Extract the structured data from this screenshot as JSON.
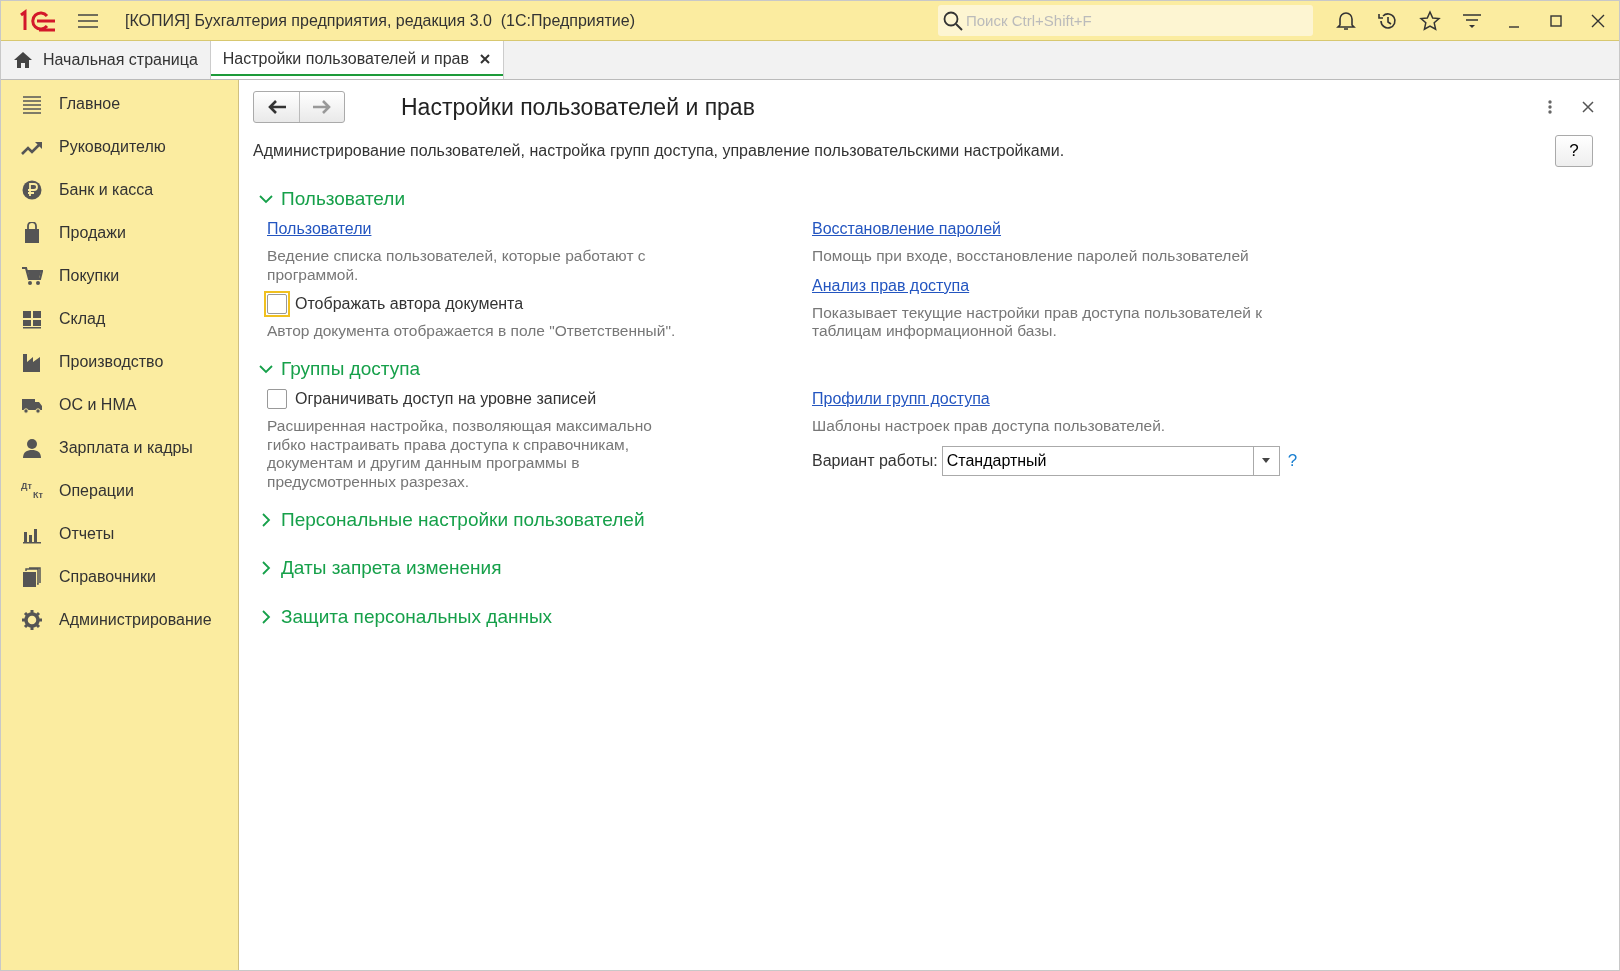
{
  "window": {
    "title": "[КОПИЯ] Бухгалтерия предприятия, редакция 3.0  (1С:Предприятие)",
    "search": {
      "placeholder": "Поиск Ctrl+Shift+F"
    }
  },
  "tabs": [
    {
      "label": "Начальная страница",
      "kind": "home",
      "selected": false
    },
    {
      "label": "Настройки пользователей и прав",
      "kind": "document",
      "selected": true
    }
  ],
  "sidebar": {
    "items": [
      {
        "label": "Главное"
      },
      {
        "label": "Руководителю"
      },
      {
        "label": "Банк и касса"
      },
      {
        "label": "Продажи"
      },
      {
        "label": "Покупки"
      },
      {
        "label": "Склад"
      },
      {
        "label": "Производство"
      },
      {
        "label": "ОС и НМА"
      },
      {
        "label": "Зарплата и кадры"
      },
      {
        "label": "Операции",
        "icon_texts": [
          "Дт",
          "Кт"
        ]
      },
      {
        "label": "Отчеты"
      },
      {
        "label": "Справочники"
      },
      {
        "label": "Администрирование"
      }
    ]
  },
  "form": {
    "title": "Настройки пользователей и прав",
    "description": "Администрирование пользователей, настройка групп доступа, управление пользовательскими настройками.",
    "help_button": "?",
    "sections": [
      {
        "title": "Пользователи",
        "expanded": true,
        "left": [
          {
            "kind": "link",
            "text": "Пользователи"
          },
          {
            "kind": "note",
            "text": "Ведение списка пользователей, которые работают с программой."
          },
          {
            "kind": "checkbox",
            "text": "Отображать автора документа",
            "checked": false,
            "focused": true
          },
          {
            "kind": "note",
            "text": "Автор документа отображается в поле \"Ответственный\"."
          }
        ],
        "right": [
          {
            "kind": "link",
            "text": "Восстановление паролей"
          },
          {
            "kind": "note",
            "text": "Помощь при входе, восстановление паролей пользователей"
          },
          {
            "kind": "link",
            "text": "Анализ прав доступа"
          },
          {
            "kind": "note",
            "text": "Показывает текущие настройки прав доступа пользователей к таблицам информационной базы."
          }
        ]
      },
      {
        "title": "Группы доступа",
        "expanded": true,
        "left": [
          {
            "kind": "checkbox",
            "text": "Ограничивать доступ на уровне записей",
            "checked": false,
            "focused": false
          },
          {
            "kind": "note",
            "text": "Расширенная настройка, позволяющая максимально гибко настраивать права доступа к справочникам, документам и другим данным программы в предусмотренных разрезах."
          }
        ],
        "right": [
          {
            "kind": "link",
            "text": "Профили групп доступа"
          },
          {
            "kind": "note",
            "text": "Шаблоны настроек прав доступа пользователей."
          },
          {
            "kind": "select",
            "label": "Вариант работы:",
            "value": "Стандартный",
            "help": "?"
          }
        ]
      },
      {
        "title": "Персональные настройки пользователей",
        "expanded": false
      },
      {
        "title": "Даты запрета изменения",
        "expanded": false
      },
      {
        "title": "Защита персональных данных",
        "expanded": false
      }
    ]
  }
}
